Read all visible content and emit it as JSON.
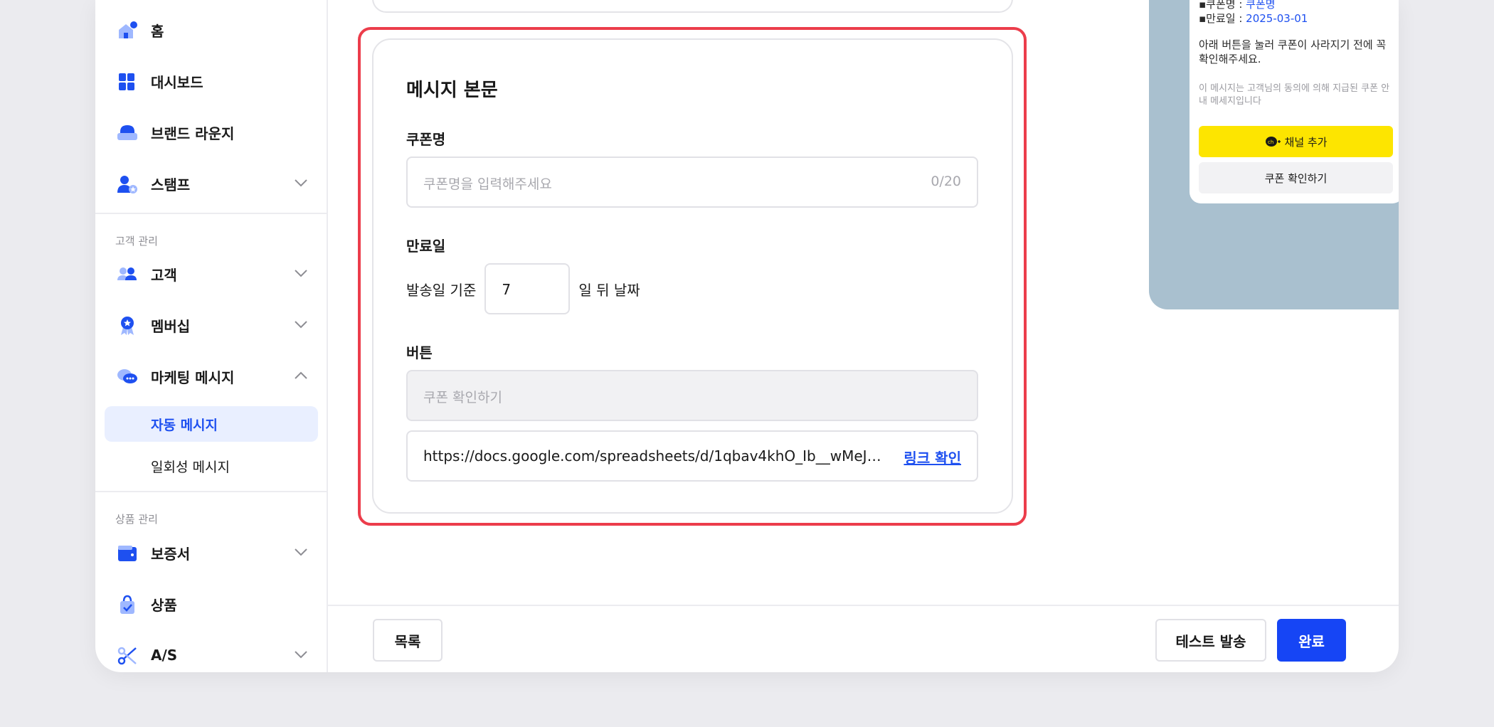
{
  "sidebar": {
    "items": {
      "home": "홈",
      "dashboard": "대시보드",
      "brand_lounge": "브랜드 라운지",
      "stamp": "스탬프",
      "customer": "고객",
      "membership": "멤버십",
      "marketing_message": "마케팅 메시지",
      "auto_message": "자동 메시지",
      "one_time_message": "일회성 메시지",
      "warranty": "보증서",
      "product": "상품",
      "as": "A/S"
    },
    "sections": {
      "customer_management": "고객 관리",
      "product_management": "상품 관리"
    }
  },
  "form": {
    "title": "메시지 본문",
    "coupon_name": {
      "label": "쿠폰명",
      "placeholder": "쿠폰명을 입력해주세요",
      "counter": "0/20"
    },
    "expiry": {
      "label": "만료일",
      "prefix": "발송일 기준",
      "days": "7",
      "suffix": "일 뒤 날짜"
    },
    "button": {
      "label": "버튼",
      "text_placeholder": "쿠폰 확인하기",
      "url": "https://docs.google.com/spreadsheets/d/1qbav4khO_Ib__wMeJu6L...",
      "link_check": "링크 확인"
    }
  },
  "preview": {
    "coupon_name_label": "▪쿠폰명 : ",
    "coupon_name_value": "쿠폰명",
    "expiry_label": "▪만료일 : ",
    "expiry_value": "2025-03-01",
    "body": "아래 버튼을 눌러 쿠폰이 사라지기 전에 꼭 확인해주세요.",
    "note": "이 메시지는 고객님의 동의에 의해 지급된 쿠폰 안내 메세지입니다",
    "add_channel": "채널 추가",
    "check_coupon": "쿠폰 확인하기"
  },
  "footer": {
    "list": "목록",
    "test_send": "테스트 발송",
    "complete": "완료"
  },
  "colors": {
    "accent": "#1645f5",
    "highlight": "#ec3d4b",
    "kakao_yellow": "#fde500",
    "preview_bg": "#a9c0cf"
  }
}
